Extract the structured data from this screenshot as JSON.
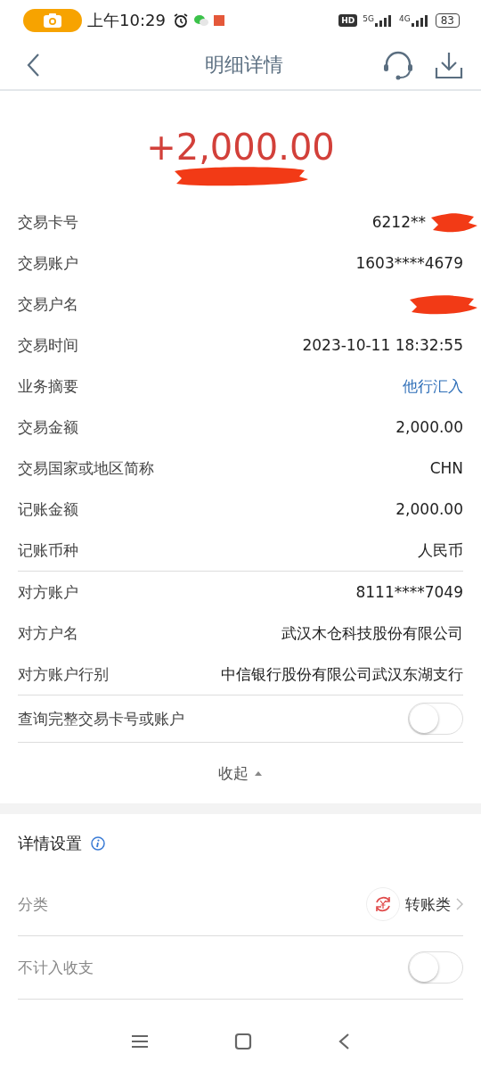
{
  "status_bar": {
    "time": "上午10:29",
    "hd": "HD",
    "networks": [
      "5G",
      "4G"
    ],
    "battery": "83"
  },
  "header": {
    "title": "明细详情"
  },
  "amount": {
    "text": "+2,000.00",
    "redacted": true
  },
  "details": [
    {
      "label": "交易卡号",
      "value": "6212**",
      "kind": "text",
      "redacted": true,
      "divider": false
    },
    {
      "label": "交易账户",
      "value": "1603****4679",
      "kind": "text",
      "redacted": false,
      "divider": false
    },
    {
      "label": "交易户名",
      "kind": "empty",
      "redacted": true,
      "divider": false
    },
    {
      "label": "交易时间",
      "value": "2023-10-11 18:32:55",
      "kind": "text",
      "redacted": false,
      "divider": false
    },
    {
      "label": "业务摘要",
      "value": "他行汇入",
      "kind": "link",
      "redacted": false,
      "divider": false
    },
    {
      "label": "交易金额",
      "value": "2,000.00",
      "kind": "text",
      "redacted": false,
      "divider": false
    },
    {
      "label": "交易国家或地区简称",
      "value": "CHN",
      "kind": "text",
      "redacted": false,
      "divider": false
    },
    {
      "label": "记账金额",
      "value": "2,000.00",
      "kind": "text",
      "redacted": false,
      "divider": false
    },
    {
      "label": "记账币种",
      "value": "人民币",
      "kind": "text",
      "redacted": false,
      "divider": true
    },
    {
      "label": "对方账户",
      "value": "8111****7049",
      "kind": "text",
      "redacted": false,
      "divider": false
    },
    {
      "label": "对方户名",
      "value": "武汉木仓科技股份有限公司",
      "kind": "text",
      "redacted": false,
      "divider": false
    },
    {
      "label": "对方账户行别",
      "value": "中信银行股份有限公司武汉东湖支行",
      "kind": "text",
      "redacted": false,
      "divider": true
    }
  ],
  "full_number_toggle": {
    "label": "查询完整交易卡号或账户",
    "on": false
  },
  "collapse": {
    "label": "收起",
    "expanded": true
  },
  "settings": {
    "title": "详情设置",
    "items": [
      {
        "kind": "category",
        "label": "分类",
        "value": "转账类"
      },
      {
        "kind": "toggle",
        "label": "不计入收支",
        "on": false
      }
    ]
  }
}
